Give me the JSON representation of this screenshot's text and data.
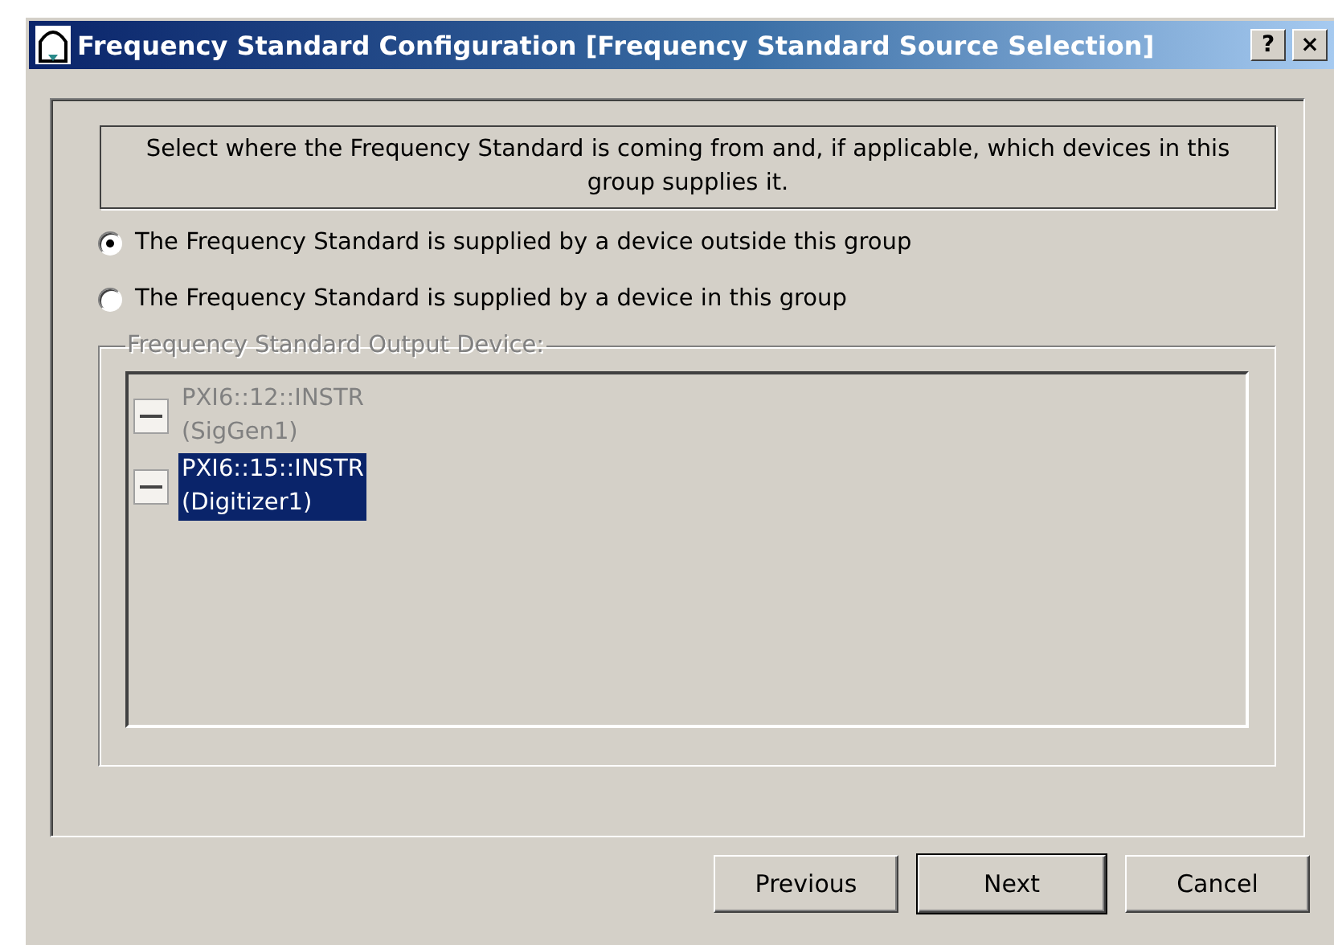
{
  "window": {
    "title": "Frequency Standard Configuration [Frequency Standard Source Selection]",
    "title_buttons": [
      "?",
      "×"
    ]
  },
  "instruction": "Select where the Frequency Standard is coming from and, if applicable, which devices in this group supplies it.",
  "options": [
    {
      "label": "The Frequency Standard is supplied by a device outside this group",
      "selected": true
    },
    {
      "label": "The Frequency Standard is supplied by a device in this group",
      "selected": false
    }
  ],
  "device_group": {
    "title": "Frequency Standard Output Device:",
    "disabled": true,
    "devices": [
      {
        "address": "PXI6::12::INSTR",
        "name": "(SigGen1)",
        "selected": false
      },
      {
        "address": "PXI6::15::INSTR",
        "name": "(Digitizer1)",
        "selected": true
      }
    ]
  },
  "buttons": [
    {
      "label": "Previous",
      "default": false
    },
    {
      "label": "Next",
      "default": true
    },
    {
      "label": "Cancel",
      "default": false
    }
  ]
}
